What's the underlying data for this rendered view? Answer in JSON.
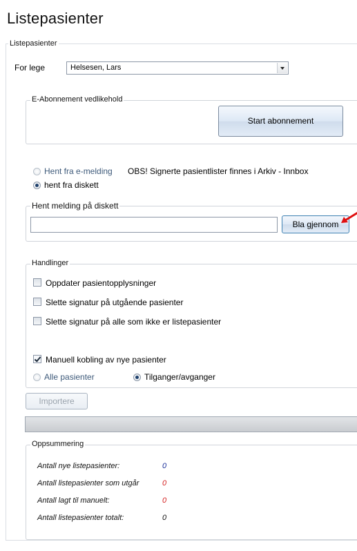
{
  "title": "Listepasienter",
  "group_label": "Listepasienter",
  "doctor": {
    "label": "For lege",
    "value": "Helsesen, Lars"
  },
  "e_abonnement": {
    "legend": "E-Abonnement vedlikehold",
    "start_button": "Start abonnement"
  },
  "source": {
    "option_email": "Hent fra e-melding",
    "note": "OBS! Signerte pasientlister finnes i Arkiv - Innbox",
    "option_diskette": "hent fra diskett",
    "selected": "hent fra diskett"
  },
  "diskette": {
    "legend": "Hent melding på diskett",
    "path_value": "",
    "browse_button": "Bla gjennom"
  },
  "actions": {
    "legend": "Handlinger",
    "update_patient": "Oppdater pasientopplysninger",
    "remove_sig_outgoing": "Slette signatur på utgående pasienter",
    "remove_sig_nonlist": "Slette signatur på alle som ikke er listepasienter",
    "manual_link": "Manuell kobling av nye pasienter",
    "all_patients": "Alle pasienter",
    "arrivals_departures": "Tilganger/avganger"
  },
  "import_button": "Importere",
  "summary": {
    "legend": "Oppsummering",
    "rows": [
      {
        "label": "Antall nye listepasienter:",
        "value": "0"
      },
      {
        "label": "Antall listepasienter som utgår",
        "value": "0"
      },
      {
        "label": "Antall lagt til manuelt:",
        "value": "0"
      },
      {
        "label": "Antall listepasienter totalt:",
        "value": "0"
      }
    ]
  },
  "colors": {
    "accent_blue": "#1a2f9a",
    "alert_red": "#d42020",
    "arrow_red": "#e01010"
  }
}
